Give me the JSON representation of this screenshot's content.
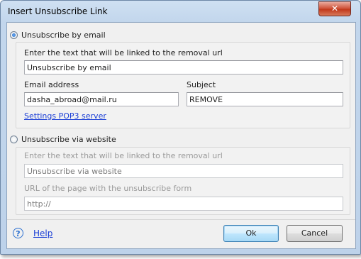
{
  "window": {
    "title": "Insert Unsubscribe Link",
    "close_label": "✕"
  },
  "email_section": {
    "radio_label": "Unsubscribe by email",
    "selected": true,
    "link_text_label": "Enter the text that will be linked to the removal url",
    "link_text_value": "Unsubscribe by email",
    "email_label": "Email address",
    "email_value": "dasha_abroad@mail.ru",
    "subject_label": "Subject",
    "subject_value": "REMOVE",
    "settings_link": "Settings POP3 server"
  },
  "website_section": {
    "radio_label": "Unsubscribe via website",
    "selected": false,
    "link_text_label": "Enter the text that will be linked to the removal url",
    "link_text_value": "Unsubscribe via website",
    "url_label": "URL of the page with the unsubscribe form",
    "url_value": "http://"
  },
  "footer": {
    "help_icon": "?",
    "help_label": "Help",
    "ok_label": "Ok",
    "cancel_label": "Cancel"
  }
}
